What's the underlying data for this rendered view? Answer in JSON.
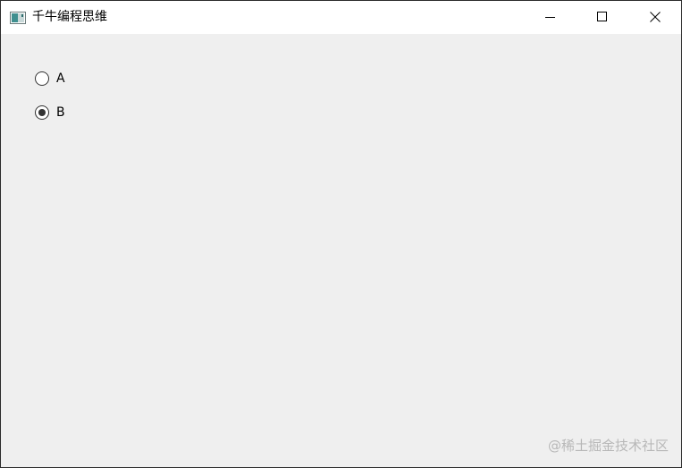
{
  "window": {
    "title": "千牛编程思维",
    "icon": "app-window-icon",
    "controls": {
      "minimize_icon": "minimize-icon",
      "maximize_icon": "maximize-icon",
      "close_icon": "close-icon"
    }
  },
  "radios": [
    {
      "label": "A",
      "checked": false
    },
    {
      "label": "B",
      "checked": true
    }
  ],
  "watermark": "@稀土掘金技术社区",
  "colors": {
    "client_background": "#efefef",
    "titlebar_background": "#ffffff",
    "radio_border": "#333333",
    "watermark": "#b8b8b8"
  }
}
